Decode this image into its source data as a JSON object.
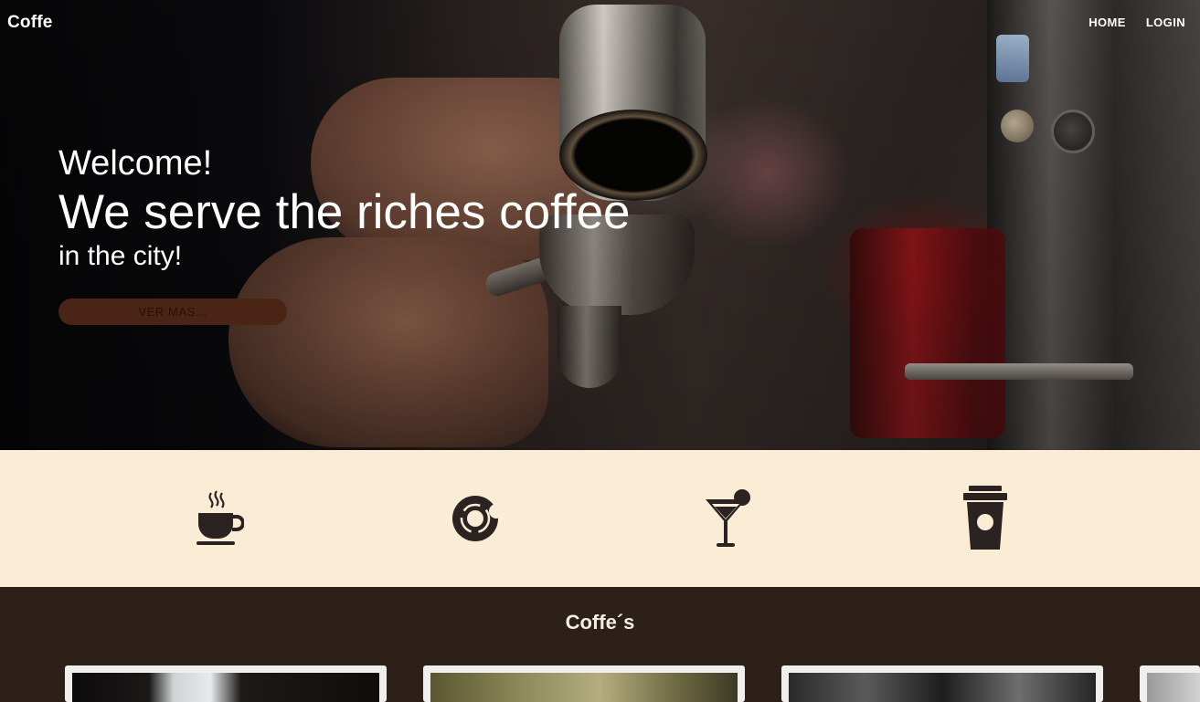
{
  "nav": {
    "brand": "Coffe",
    "links": [
      "HOME",
      "LOGIN"
    ]
  },
  "hero": {
    "welcome": "Welcome!",
    "headline": "We serve the riches coffee",
    "subline": "in the city!",
    "cta_label": "VER MAS..."
  },
  "features": {
    "icons": [
      "hot-coffee-cup-icon",
      "donut-icon",
      "cocktail-icon",
      "takeaway-coffee-cup-icon"
    ]
  },
  "coffees": {
    "title": "Coffe´s"
  },
  "colors": {
    "cream": "#fbecd5",
    "dark_brown": "#2c2019",
    "cta": "#4a2414",
    "icon": "#2b2321"
  }
}
